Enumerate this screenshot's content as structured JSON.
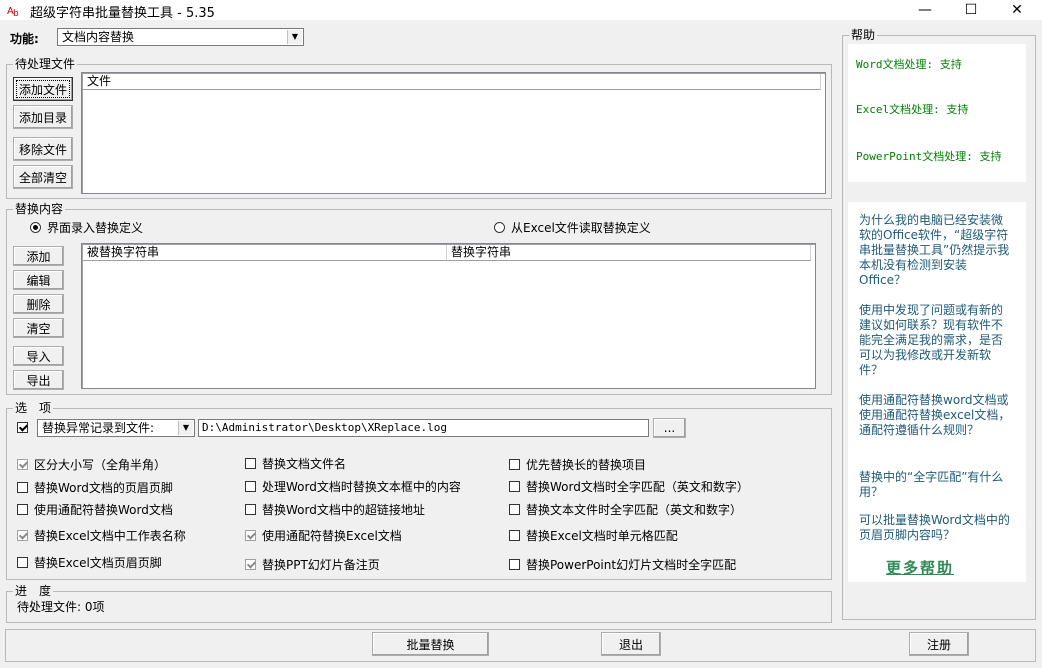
{
  "window": {
    "title": "超级字符串批量替换工具 - 5.35",
    "minimize": "—",
    "maximize": "☐",
    "close": "✕"
  },
  "function": {
    "label": "功能:",
    "selected": "文档内容替换"
  },
  "pending_files": {
    "title": "待处理文件",
    "buttons": {
      "add_file": "添加文件",
      "add_dir": "添加目录",
      "remove_file": "移除文件",
      "clear_all": "全部清空"
    },
    "column": "文件"
  },
  "replace": {
    "title": "替换内容",
    "radio_ui": "界面录入替换定义",
    "radio_excel": "从Excel文件读取替换定义",
    "buttons": {
      "add": "添加",
      "edit": "编辑",
      "delete": "删除",
      "clear": "清空",
      "import": "导入",
      "export": "导出"
    },
    "col_find": "被替换字符串",
    "col_replace": "替换字符串"
  },
  "options": {
    "title": "选　项",
    "log_mode": "替换异常记录到文件:",
    "log_path": "D:\\Administrator\\Desktop\\XReplace.log",
    "browse": "...",
    "checks": {
      "case": "区分大小写（全角半角）",
      "rename": "替换文档文件名",
      "long_first": "优先替换长的替换项目",
      "word_header": "替换Word文档的页眉页脚",
      "word_textbox": "处理Word文档时替换文本框中的内容",
      "word_whole": "替换Word文档时全字匹配（英文和数字）",
      "word_wildcard": "使用通配符替换Word文档",
      "word_hyperlink": "替换Word文档中的超链接地址",
      "text_whole": "替换文本文件时全字匹配（英文和数字）",
      "excel_sheet": "替换Excel文档中工作表名称",
      "excel_wildcard": "使用通配符替换Excel文档",
      "excel_cell": "替换Excel文档时单元格匹配",
      "excel_header": "替换Excel文档页眉页脚",
      "ppt_notes": "替换PPT幻灯片备注页",
      "ppt_whole": "替换PowerPoint幻灯片文档时全字匹配"
    }
  },
  "progress": {
    "title": "进　度",
    "status": "待处理文件: 0项"
  },
  "bottom": {
    "batch": "批量替换",
    "exit": "退出",
    "register": "注册"
  },
  "help": {
    "title": "帮助",
    "word_support": "Word文档处理: 支持",
    "excel_support": "Excel文档处理: 支持",
    "ppt_support": "PowerPoint文档处理: 支持",
    "faq1": "为什么我的电脑已经安装微软的Office软件，“超级字符串批量替换工具”仍然提示我本机没有检测到安装Office？",
    "faq2": "使用中发现了问题或有新的建议如何联系？现有软件不能完全满足我的需求，是否可以为我修改或开发新软件？",
    "faq3": "使用通配符替换word文档或使用通配符替换excel文档，通配符遵循什么规则？",
    "faq4": "替换中的“全字匹配”有什么用？",
    "faq5": "可以批量替换Word文档中的页眉页脚内容吗？",
    "more": "更多帮助"
  },
  "colors": {
    "help_green": "#008000",
    "help_link": "#1e5a78",
    "more_help": "#2e8b57"
  }
}
